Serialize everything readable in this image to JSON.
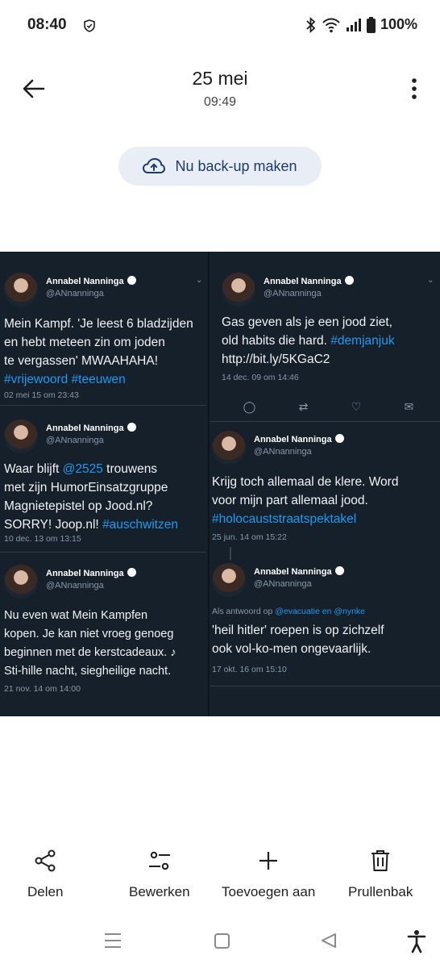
{
  "status": {
    "time": "08:40",
    "battery": "100%"
  },
  "header": {
    "date": "25 mei",
    "time": "09:49"
  },
  "backup": {
    "label": "Nu back-up maken"
  },
  "tweets": [
    {
      "name": "Annabel Nanninga",
      "handle": "@ANnanninga",
      "lines": [
        "Mein Kampf. 'Je leest 6 bladzijden",
        "en hebt meteen zin om joden",
        "te vergassen' MWAAHAHA!"
      ],
      "tags": "#vrijewoord #teeuwen",
      "date": "02 mei 15 om 23:43"
    },
    {
      "name": "Annabel Nanninga",
      "handle": "@ANnanninga",
      "line1_pre": "Waar blijft ",
      "line1_mention": "@2525",
      "line1_post": " trouwens",
      "lines": [
        "met zijn HumorEinsatzgruppe",
        "Magnietepistel op Jood.nl?"
      ],
      "last_pre": "SORRY! Joop.nl! ",
      "last_tag": "#auschwitzen",
      "date": "10 dec. 13 om 13:15"
    },
    {
      "name": "Annabel Nanninga",
      "handle": "@ANnanninga",
      "lines": [
        "Nu even wat Mein Kampfen",
        "kopen. Je kan niet vroeg genoeg",
        "beginnen met de kerstcadeaux. ♪",
        "Sti-hille nacht, siegheilige nacht."
      ],
      "date": "21 nov. 14 om 14:00"
    },
    {
      "name": "Annabel Nanninga",
      "handle": "@ANnanninga",
      "lines": [
        "Gas geven als je een jood ziet,"
      ],
      "line2_pre": "old habits die hard. ",
      "line2_tag": "#demjanjuk",
      "line3": "http://bit.ly/5KGaC2",
      "date": "14 dec. 09 om 14:46"
    },
    {
      "name": "Annabel Nanninga",
      "handle": "@ANnanninga",
      "lines": [
        "Krijg toch allemaal de klere. Word",
        "voor mijn part allemaal jood."
      ],
      "tag": "#holocauststraatspektakel",
      "date": "25 jun. 14 om 15:22"
    },
    {
      "name": "Annabel Nanninga",
      "handle": "@ANnanninga",
      "reply_pre": "Als antwoord op ",
      "reply_to": "@evacuatie en @nynke",
      "lines": [
        "'heil hitler' roepen is op zichzelf",
        "ook vol-ko-men ongevaarlijk."
      ],
      "date": "17 okt. 16 om 15:10"
    }
  ],
  "toolbar": {
    "share": "Delen",
    "edit": "Bewerken",
    "add": "Toevoegen aan",
    "trash": "Prullenbak"
  },
  "colors": {
    "accent": "#1b3b6f",
    "pill": "#e8edf6",
    "tweet_bg": "#15202b",
    "link": "#1d9bf0"
  }
}
